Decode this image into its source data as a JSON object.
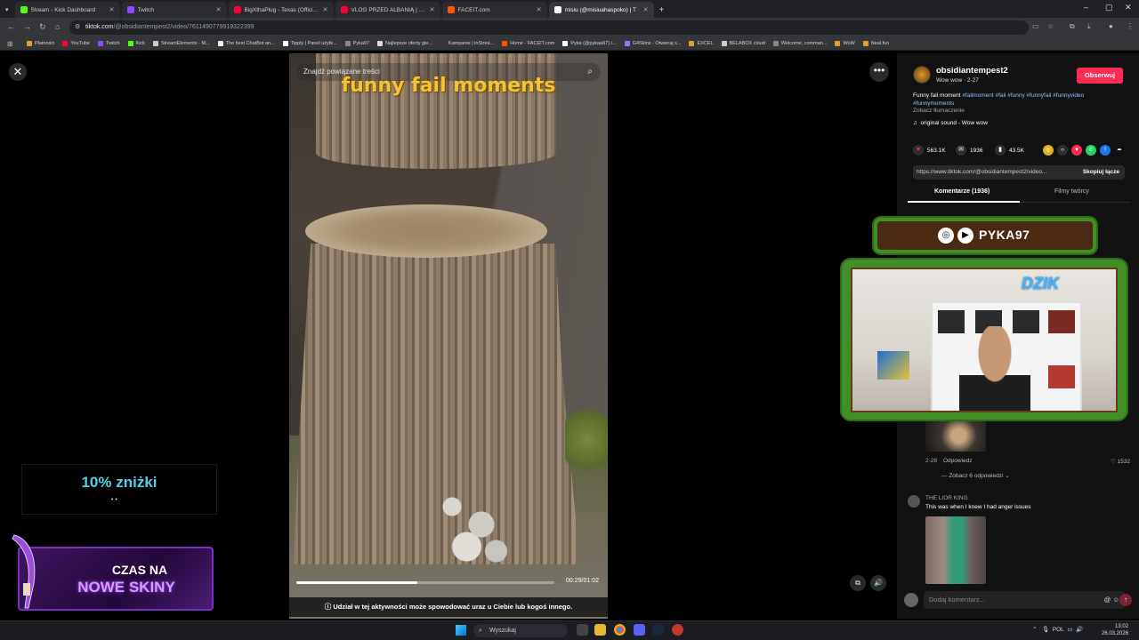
{
  "browser": {
    "tabs": [
      {
        "title": "Stream - Kick Dashboard",
        "color": "#53fc18",
        "active": false
      },
      {
        "title": "Twitch",
        "color": "#9146ff",
        "active": false
      },
      {
        "title": "BigXthaPlug - Texas (Official M",
        "color": "#ff0033",
        "active": false
      },
      {
        "title": "VLOG PRZED ALBANIĄ | Cały vl",
        "color": "#ff0033",
        "active": false
      },
      {
        "title": "FACEIT.com",
        "color": "#ff5500",
        "active": false
      },
      {
        "title": "misiu (@misiuahaspoko) | T",
        "color": "#ffffff",
        "active": true
      }
    ],
    "url_domain": "tiktok.com",
    "url_path": "/@obsidiantempest2/video/7611490779919322399",
    "bookmarks": [
      {
        "label": "Płatności",
        "color": "#e0a030"
      },
      {
        "label": "YouTube",
        "color": "#ff0033"
      },
      {
        "label": "Twitch",
        "color": "#9146ff"
      },
      {
        "label": "Kick",
        "color": "#53fc18"
      },
      {
        "label": "StreamElements - M...",
        "color": "#cccccc"
      },
      {
        "label": "The best ChatBot an...",
        "color": "#eeeeee"
      },
      {
        "label": "Tipply | Panel użytk...",
        "color": "#ffffff"
      },
      {
        "label": "Pyka97",
        "color": "#888888"
      },
      {
        "label": "Najlepsze oferty gie...",
        "color": "#dddddd"
      },
      {
        "label": "Kampanie | inStrea...",
        "color": "#333333"
      },
      {
        "label": "Home - FACEIT.com",
        "color": "#ff5500"
      },
      {
        "label": "Pyka (@pykaa97) /...",
        "color": "#ffffff"
      },
      {
        "label": "G4Skins - Otwieraj s...",
        "color": "#a070ff"
      },
      {
        "label": "EXCEL",
        "color": "#e0a030"
      },
      {
        "label": "BELABOX cloud",
        "color": "#cccccc"
      },
      {
        "label": "Welcome, comman...",
        "color": "#888888"
      },
      {
        "label": "WoW",
        "color": "#e0a030"
      },
      {
        "label": "Neal.fun",
        "color": "#e0a030"
      }
    ]
  },
  "video": {
    "search_placeholder": "Znajdź powiązane treści",
    "caption": "funny fail moments",
    "time": "00:29/01:02",
    "progress": 0.47,
    "warning": "Udział w tej aktywności może spowodować uraz u Ciebie lub kogoś innego."
  },
  "post": {
    "username": "obsidiantempest2",
    "subline": "Wow wow · 2-27",
    "follow_label": "Obserwuj",
    "desc_lead": "Funny fail moment ",
    "hashtags": "#failmoment #fail #funny #funnyfail #funnyvideo #funnymoments",
    "translate": "Zobacz tłumaczenie",
    "sound": "original sound - Wow wow",
    "likes": "563.1K",
    "comments": "1936",
    "saves": "43.5K",
    "link": "https://www.tiktok.com/@obsidiantempest2/video...",
    "copy_label": "Skopiuj łącze",
    "tab_comments": "Komentarze (1936)",
    "tab_creator": "Filmy twórcy"
  },
  "comments": {
    "first": {
      "date": "2-28",
      "reply": "Odpowiedz",
      "likes": "1532",
      "more": "Zobacz 6 odpowiedzi"
    },
    "second": {
      "user": "THE LIOR KING",
      "text": "This was when I knew I had anger issues"
    },
    "input_placeholder": "Dodaj komentarz..."
  },
  "overlays": {
    "promo": "10% zniżki",
    "promo_dots": "• •",
    "skins_line1": "CZAS NA",
    "skins_line2": "NOWE SKINY",
    "streamer": "PYKA97",
    "webcam_logo": "DZIK"
  },
  "taskbar": {
    "search": "Wyszukaj",
    "lang": "POL",
    "time": "13:02",
    "date": "26.03.2026"
  }
}
